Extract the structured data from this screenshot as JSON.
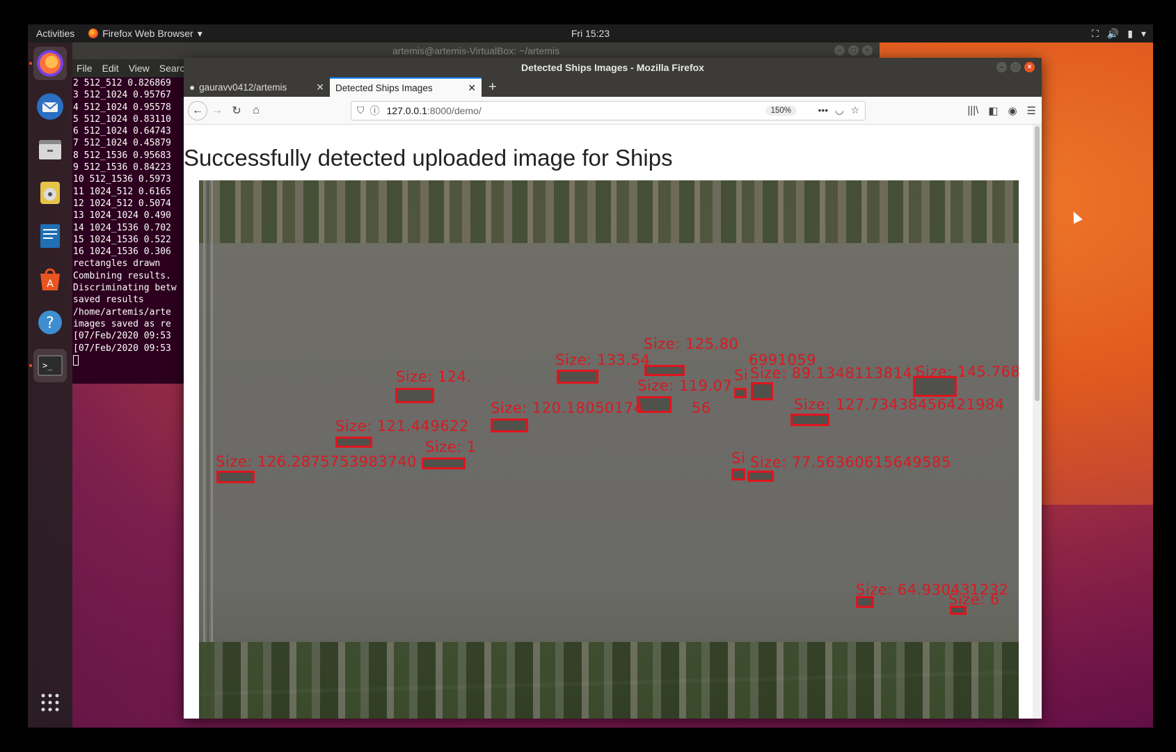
{
  "topbar": {
    "activities": "Activities",
    "app_menu": "Firefox Web Browser",
    "clock": "Fri 15:23"
  },
  "dock": {
    "items": [
      "firefox-icon",
      "thunderbird-icon",
      "files-icon",
      "rhythmbox-icon",
      "writer-icon",
      "software-icon",
      "help-icon",
      "terminal-icon"
    ],
    "show_apps": "apps-grid-icon"
  },
  "terminal": {
    "title": "artemis@artemis-VirtualBox: ~/artemis",
    "menu": [
      "File",
      "Edit",
      "View",
      "Search"
    ],
    "lines": [
      "2 512_512 0.826869",
      "3 512_1024 0.95767",
      "4 512_1024 0.95578",
      "5 512_1024 0.83110",
      "6 512_1024 0.64743",
      "7 512_1024 0.45879",
      "8 512_1536 0.95683",
      "9 512_1536 0.84223",
      "10 512_1536 0.5973",
      "11 1024_512 0.6165",
      "12 1024_512 0.5074",
      "13 1024_1024 0.490",
      "14 1024_1536 0.702",
      "15 1024_1536 0.522",
      "16 1024_1536 0.306",
      "rectangles drawn",
      "Combining results.",
      "Discriminating betw",
      "saved results",
      "/home/artemis/arte",
      "images saved as re",
      "[07/Feb/2020 09:53",
      "[07/Feb/2020 09:53"
    ]
  },
  "firefox": {
    "window_title": "Detected Ships Images - Mozilla Firefox",
    "tabs": [
      {
        "label": "gauravv0412/artemis",
        "active": false
      },
      {
        "label": "Detected Ships Images",
        "active": true
      }
    ],
    "url_host": "127.0.0.1",
    "url_rest": ":8000/demo/",
    "zoom": "150%"
  },
  "page": {
    "heading": "Successfully detected uploaded image for Ships",
    "detections": [
      "Size: 125.80",
      "Size: 133.54",
      "6991059",
      "Size: 124.",
      "Size: 119.07",
      "Si",
      "Size: 89.13481138141",
      "Size: 145.768",
      "Size: 120.18050174",
      "56",
      "Size: 127.73438456421984",
      "Size: 121.449622",
      "Size: 1",
      "Size: 126.2875753983740",
      "Si",
      "Size: 77.56360615649585",
      "Size: 64.930431232",
      "Size: 6"
    ]
  }
}
